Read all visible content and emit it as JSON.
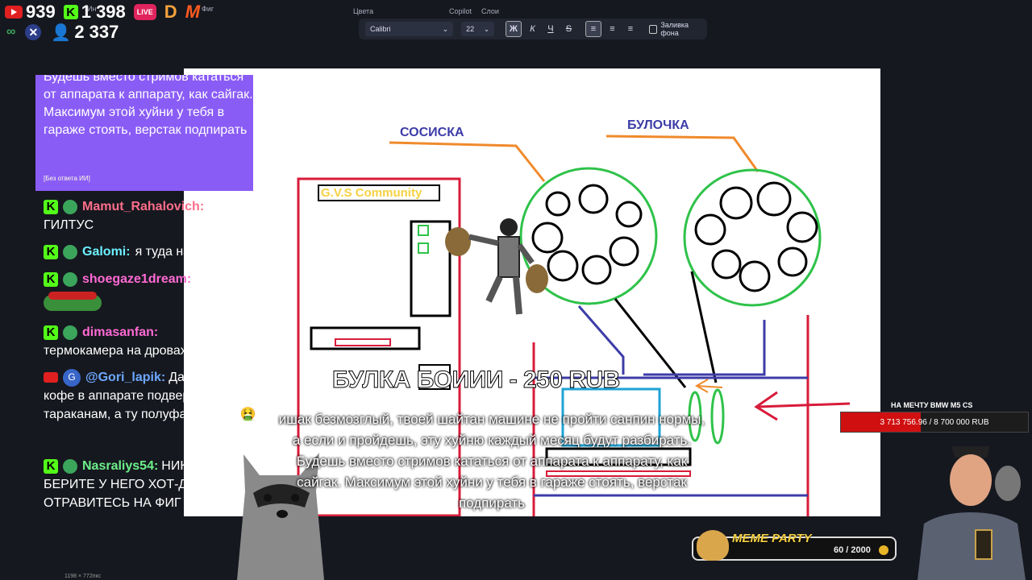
{
  "top_stats": {
    "youtube_count": "939",
    "kick_count": "1 398",
    "live_badge": "LIVE",
    "partial_label_1": "Ин",
    "partial_label_2": "Фиг",
    "viewers": "2 337"
  },
  "editor": {
    "menu": {
      "colors": "Цвета",
      "copilot": "Copilot",
      "layers": "Слои"
    },
    "font_name": "Calibri",
    "font_size": "22",
    "bold": "Ж",
    "italic": "К",
    "underline": "Ч",
    "strike": "S",
    "fill_label": "Заливка фона",
    "status": "1198 × 772пкс"
  },
  "canvas": {
    "label_sausage": "СОСИСКА",
    "label_bun": "БУЛОЧКА",
    "community": "G.V.S Community"
  },
  "chat": {
    "highlight_text": "Будешь вместо стримов кататься от аппарата к аппарату, как сайгак. Максимум этой хуйни у тебя в гараже стоять, верстак подпирать",
    "highlight_tag": "[Без ответа ИИ]",
    "messages": [
      {
        "user": "Mamut_Rahalovich:",
        "text": "ГИЛТУС"
      },
      {
        "user": "Galomi:",
        "text": "я туда насру"
      },
      {
        "user": "shoegaze1dream:",
        "text": ""
      },
      {
        "user": "dimasanfan:",
        "text": "термокамера на дровах"
      },
      {
        "user": "@Gori_lapik:",
        "text": "Даже сухое кофе в аппарате подвержено тараканам, а ту полуфабрикаты 🤮"
      },
      {
        "user": "Nasraliys54:",
        "text": "НИКОГДА НЕ БЕРИТЕ У НЕГО ХОТ-ДОГ ОТРАВИТЕСЬ НА ФИГ"
      }
    ],
    "gori_avatar": "G"
  },
  "donation": {
    "title": "БУЛКА БОИИИ - 250 RUB",
    "text": "ишак безмозглый, твоей шайтан машине не пройти санпин нормы, а если и пройдешь, эту хуйню каждый месяц будут разбирать. Будешь вместо стримов кататься от аппарата к аппарату, как сайгак. Максимум этой хуйни у тебя в гараже стоять, верстак подпирать"
  },
  "goal": {
    "title": "НА МЕЧТУ BMW M5 CS",
    "progress": "3 713 756.96 / 8 700 000 RUB",
    "fraction": 0.427
  },
  "meme_party": {
    "title": "MEME PARTY",
    "count": "60 / 2000",
    "fraction": 0.03
  }
}
